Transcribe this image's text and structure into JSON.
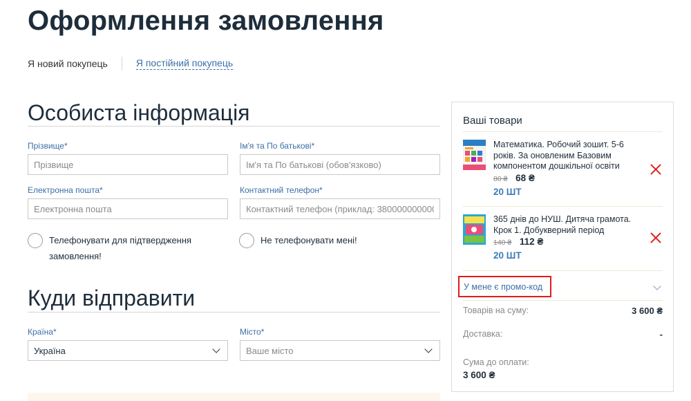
{
  "page": {
    "title": "Оформлення замовлення"
  },
  "customer_type": {
    "new": "Я новий покупець",
    "returning": "Я постійний покупець"
  },
  "personal": {
    "title": "Особиста інформація",
    "surname": {
      "label": "Прізвище*",
      "placeholder": "Прізвище",
      "value": ""
    },
    "name": {
      "label": "Ім'я та По батькові*",
      "placeholder": "Ім'я та По батькові (обов'язково)",
      "value": ""
    },
    "email": {
      "label": "Електронна пошта*",
      "placeholder": "Електронна пошта",
      "value": ""
    },
    "phone": {
      "label": "Контактний телефон*",
      "placeholder": "Контактний телефон (приклад: 380000000000)",
      "value": ""
    },
    "call_confirm": {
      "line1": "Телефонувати для підтвердження",
      "line2": "замовлення!"
    },
    "no_call": "Не телефонувати мені!"
  },
  "shipping": {
    "title": "Куди відправити",
    "country": {
      "label": "Країна*",
      "value": "Україна"
    },
    "city": {
      "label": "Місто*",
      "placeholder": "Ваше місто"
    }
  },
  "cart": {
    "title": "Ваші товари",
    "items": [
      {
        "name": "Математика. Робочий зошит. 5-6 років. За оновленим Базовим компонентом дошкільної освіти",
        "old_price": "80 ₴",
        "price": "68 ₴",
        "qty": "20 ШТ"
      },
      {
        "name": "365 днів до НУШ. Дитяча грамота. Крок 1. Добукверний період",
        "old_price": "140 ₴",
        "price": "112 ₴",
        "qty": "20 ШТ"
      }
    ],
    "promo": "У мене є промо-код",
    "subtotal": {
      "label": "Товарів на суму:",
      "value": "3 600 ₴"
    },
    "delivery": {
      "label": "Доставка:",
      "value": "-"
    },
    "total": {
      "label": "Сума до оплати:",
      "value": "3 600 ₴"
    }
  },
  "colors": {
    "accent": "#3b6ea8",
    "title": "#1e2d3b",
    "remove": "#e02020",
    "promo_border": "#e21a1a"
  }
}
